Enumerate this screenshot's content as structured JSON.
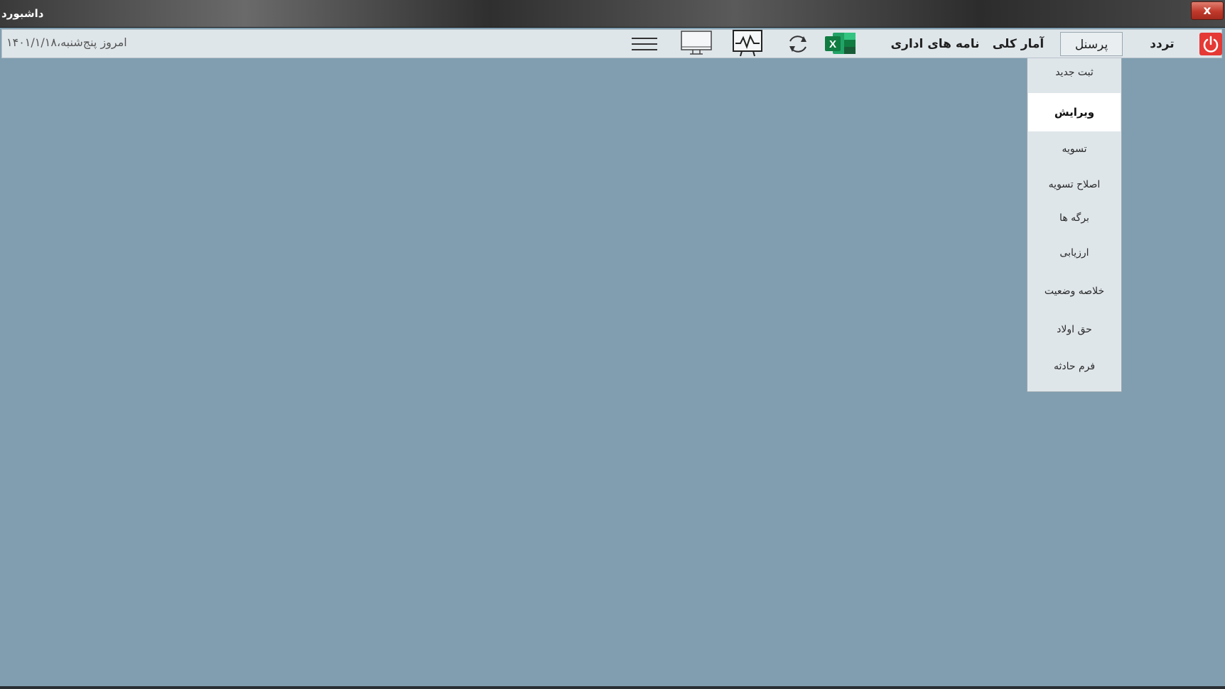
{
  "window": {
    "title": "داشبورد",
    "close_label": "x"
  },
  "toolbar": {
    "date_text": "امروز  پنج‌شنبه،۱۴۰۱/۱/۱۸",
    "menu": [
      {
        "label": "تردد"
      },
      {
        "label": "پرسنل"
      },
      {
        "label": "آمار کلی"
      },
      {
        "label": "نامه های اداری"
      }
    ],
    "icons": [
      "power-icon",
      "excel-icon",
      "refresh-icon",
      "chart-monitor-icon",
      "monitor-icon",
      "hamburger-menu-icon"
    ],
    "accent_colors": {
      "power": "#e53935",
      "excel": "#1e7e45"
    }
  },
  "dropdown": {
    "items": [
      {
        "label": "ثبت جدید"
      },
      {
        "label": "ویرایش"
      },
      {
        "label": "تسویه"
      },
      {
        "label": "اصلاح تسویه"
      },
      {
        "label": "برگه ها"
      },
      {
        "label": "ارزیابی"
      },
      {
        "label": "خلاصه وضعیت"
      },
      {
        "label": "حق اولاد"
      },
      {
        "label": "فرم حادثه"
      }
    ],
    "selected": "ویرایش"
  },
  "colors": {
    "background": "#809eb0",
    "toolbar": "#dfe6ea"
  }
}
